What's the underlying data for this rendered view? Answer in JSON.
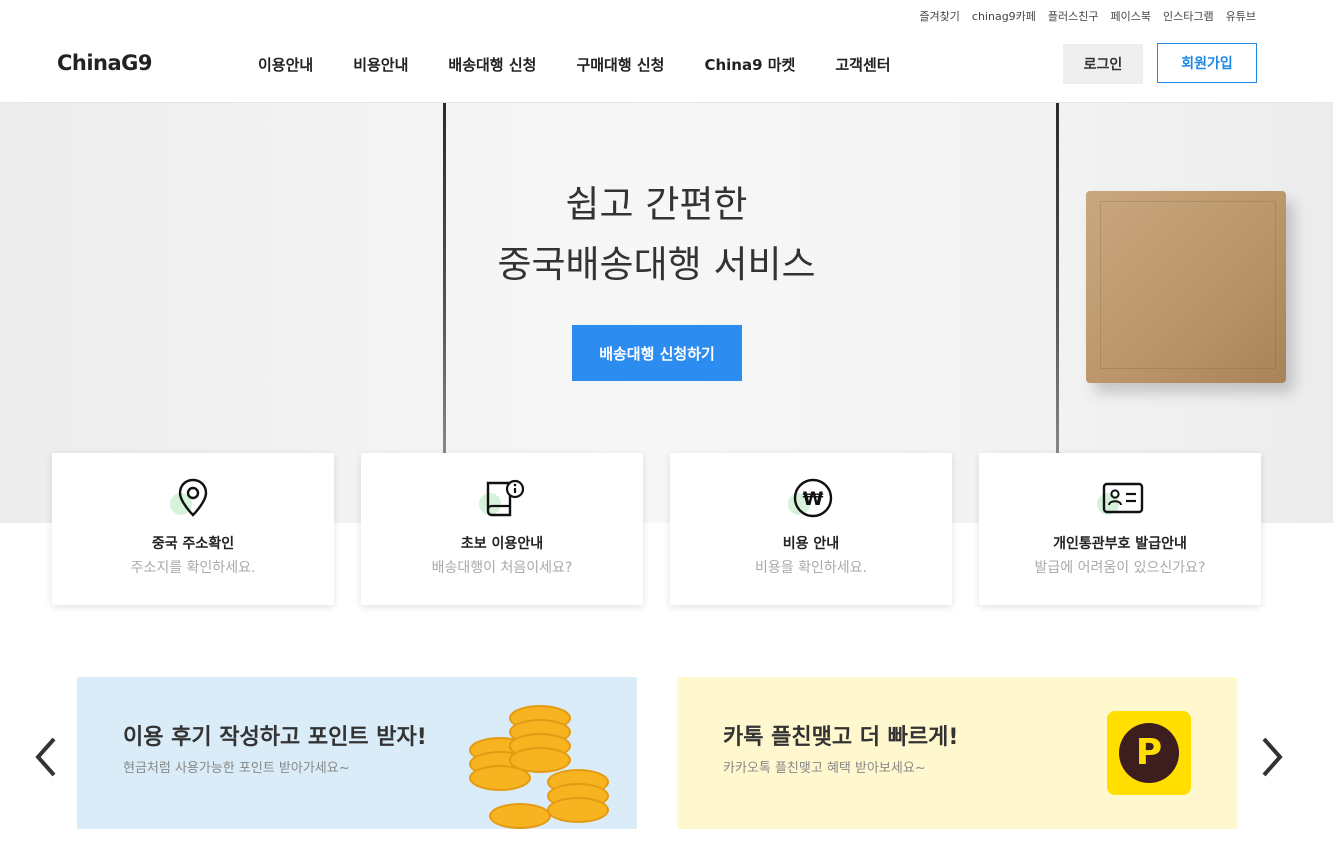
{
  "utility": [
    "즐겨찾기",
    "chinag9카페",
    "플러스친구",
    "페이스북",
    "인스타그램",
    "유튜브"
  ],
  "header": {
    "logo": "ChinaG9",
    "nav": [
      "이용안내",
      "비용안내",
      "배송대행 신청",
      "구매대행 신청",
      "China9 마켓",
      "고객센터"
    ],
    "login": "로그인",
    "join": "회원가입"
  },
  "hero": {
    "line1": "쉽고 간편한",
    "line2": "중국배송대행 서비스",
    "cta": "배송대행 신청하기"
  },
  "cards": [
    {
      "icon": "location-pin-icon",
      "title": "중국 주소확인",
      "sub": "주소지를 확인하세요."
    },
    {
      "icon": "book-info-icon",
      "title": "초보 이용안내",
      "sub": "배송대행이 처음이세요?"
    },
    {
      "icon": "won-icon",
      "title": "비용 안내",
      "sub": "비용을 확인하세요."
    },
    {
      "icon": "id-card-icon",
      "title": "개인통관부호 발급안내",
      "sub": "발급에 어려움이 있으신가요?"
    }
  ],
  "banners": [
    {
      "title": "이용 후기 작성하고 포인트 받자!",
      "sub": "현금처럼 사용가능한 포인트 받아가세요~"
    },
    {
      "title": "카톡 플친맺고 더 빠르게!",
      "sub": "카카오톡 플친맺고 혜택 받아보세요~",
      "badge": "P"
    }
  ],
  "colors": {
    "primary": "#2d8cf0",
    "join_border": "#1e88e5",
    "banner1": "#d9ecf7",
    "banner2": "#fff8cf",
    "kakao": "#ffde00"
  }
}
